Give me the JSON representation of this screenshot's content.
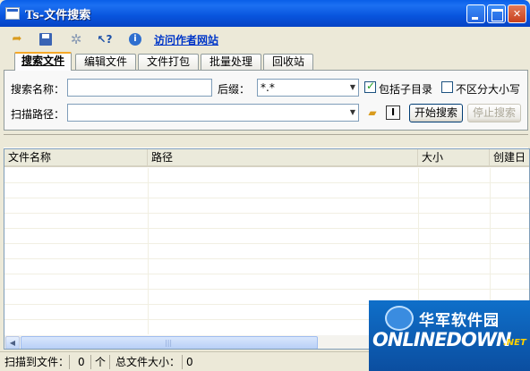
{
  "window": {
    "title": "Ts-文件搜索"
  },
  "toolbar": {
    "icons": [
      "open-folder-icon",
      "save-icon",
      "settings-icon",
      "help-pointer-icon",
      "info-icon"
    ],
    "visit_link": "访问作者网站"
  },
  "tabs": [
    {
      "label": "搜索文件",
      "active": true
    },
    {
      "label": "编辑文件",
      "active": false
    },
    {
      "label": "文件打包",
      "active": false
    },
    {
      "label": "批量处理",
      "active": false
    },
    {
      "label": "回收站",
      "active": false
    }
  ],
  "search": {
    "name_label": "搜索名称：",
    "name_value": "",
    "suffix_label": "后缀：",
    "suffix_value": "*.*",
    "include_subdirs_label": "包括子目录",
    "include_subdirs_checked": true,
    "case_insensitive_label": "不区分大小写",
    "case_insensitive_checked": false,
    "path_label": "扫描路径：",
    "path_value": "",
    "start_button": "开始搜索",
    "stop_button": "停止搜索"
  },
  "results": {
    "columns": [
      "文件名称",
      "路径",
      "大小",
      "创建日"
    ],
    "rows": []
  },
  "status": {
    "scanned_label": "扫描到文件：",
    "scanned_count": "0",
    "unit": "个",
    "total_size_label": "总文件大小：",
    "total_size": "0"
  },
  "watermark": {
    "cn": "华军软件园",
    "en": "ONLINEDOWN",
    "net": ".NET"
  },
  "colors": {
    "title_bar": "#0a5fe8",
    "active_tab_accent": "#f5a829",
    "link": "#0037c8",
    "watermark_bg": "#0f6fc9"
  }
}
